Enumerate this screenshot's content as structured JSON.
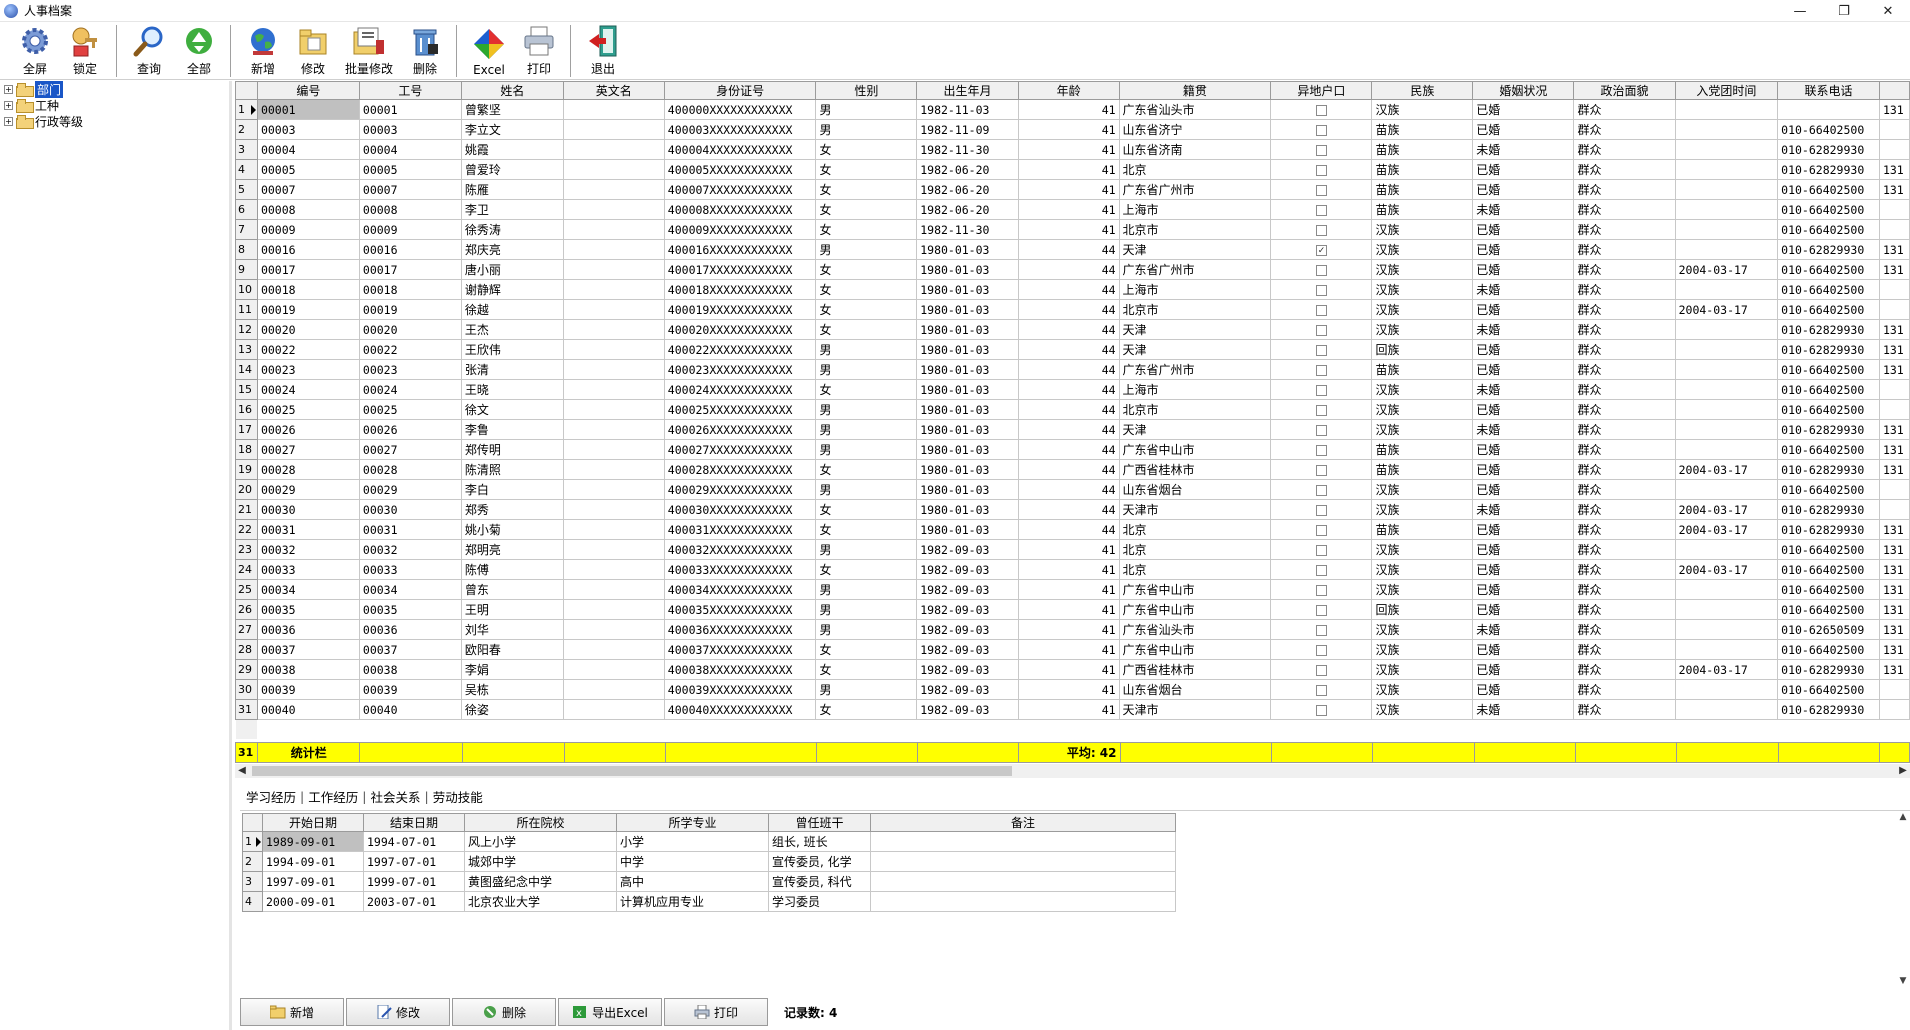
{
  "window": {
    "title": "人事档案",
    "controls": [
      "—",
      "❐",
      "✕"
    ]
  },
  "toolbar": {
    "groups": [
      [
        {
          "label": "全屏",
          "icon": "gear-icon"
        },
        {
          "label": "锁定",
          "icon": "lock-icon"
        }
      ],
      [
        {
          "label": "查询",
          "icon": "magnifier-icon"
        },
        {
          "label": "全部",
          "icon": "recycle-icon"
        }
      ],
      [
        {
          "label": "新增",
          "icon": "globe-icon"
        },
        {
          "label": "修改",
          "icon": "folder-edit-icon"
        },
        {
          "label": "批量修改",
          "icon": "batch-edit-icon"
        },
        {
          "label": "删除",
          "icon": "trash-icon"
        }
      ],
      [
        {
          "label": "Excel",
          "icon": "excel-icon"
        },
        {
          "label": "打印",
          "icon": "printer-icon"
        }
      ],
      [
        {
          "label": "退出",
          "icon": "exit-icon"
        }
      ]
    ]
  },
  "tree": [
    {
      "label": "部门",
      "checked": true,
      "selected": true
    },
    {
      "label": "工种",
      "checked": false,
      "selected": false
    },
    {
      "label": "行政等级",
      "checked": false,
      "selected": false
    }
  ],
  "grid": {
    "columns": [
      "编号",
      "工号",
      "姓名",
      "英文名",
      "身份证号",
      "性别",
      "出生年月",
      "年龄",
      "籍贯",
      "异地户口",
      "民族",
      "婚姻状况",
      "政治面貌",
      "入党团时间",
      "联系电话",
      ""
    ],
    "rows": [
      [
        "00001",
        "00001",
        "曾繁坚",
        "",
        "400000XXXXXXXXXXXX",
        "男",
        "1982-11-03",
        "41",
        "广东省汕头市",
        false,
        "汉族",
        "已婚",
        "群众",
        "",
        "",
        "131"
      ],
      [
        "00003",
        "00003",
        "李立文",
        "",
        "400003XXXXXXXXXXXX",
        "男",
        "1982-11-09",
        "41",
        "山东省济宁",
        false,
        "苗族",
        "已婚",
        "群众",
        "",
        "010-66402500",
        ""
      ],
      [
        "00004",
        "00004",
        "姚霞",
        "",
        "400004XXXXXXXXXXXX",
        "女",
        "1982-11-30",
        "41",
        "山东省济南",
        false,
        "苗族",
        "未婚",
        "群众",
        "",
        "010-62829930",
        ""
      ],
      [
        "00005",
        "00005",
        "曾爱玲",
        "",
        "400005XXXXXXXXXXXX",
        "女",
        "1982-06-20",
        "41",
        "北京",
        false,
        "苗族",
        "已婚",
        "群众",
        "",
        "010-62829930",
        "131"
      ],
      [
        "00007",
        "00007",
        "陈雁",
        "",
        "400007XXXXXXXXXXXX",
        "女",
        "1982-06-20",
        "41",
        "广东省广州市",
        false,
        "苗族",
        "已婚",
        "群众",
        "",
        "010-66402500",
        "131"
      ],
      [
        "00008",
        "00008",
        "李卫",
        "",
        "400008XXXXXXXXXXXX",
        "女",
        "1982-06-20",
        "41",
        "上海市",
        false,
        "苗族",
        "未婚",
        "群众",
        "",
        "010-66402500",
        ""
      ],
      [
        "00009",
        "00009",
        "徐秀涛",
        "",
        "400009XXXXXXXXXXXX",
        "女",
        "1982-11-30",
        "41",
        "北京市",
        false,
        "汉族",
        "已婚",
        "群众",
        "",
        "010-66402500",
        ""
      ],
      [
        "00016",
        "00016",
        "郑庆亮",
        "",
        "400016XXXXXXXXXXXX",
        "男",
        "1980-01-03",
        "44",
        "天津",
        true,
        "汉族",
        "已婚",
        "群众",
        "",
        "010-62829930",
        "131"
      ],
      [
        "00017",
        "00017",
        "唐小丽",
        "",
        "400017XXXXXXXXXXXX",
        "女",
        "1980-01-03",
        "44",
        "广东省广州市",
        false,
        "汉族",
        "已婚",
        "群众",
        "2004-03-17",
        "010-66402500",
        "131"
      ],
      [
        "00018",
        "00018",
        "谢静辉",
        "",
        "400018XXXXXXXXXXXX",
        "女",
        "1980-01-03",
        "44",
        "上海市",
        false,
        "汉族",
        "未婚",
        "群众",
        "",
        "010-66402500",
        ""
      ],
      [
        "00019",
        "00019",
        "徐越",
        "",
        "400019XXXXXXXXXXXX",
        "女",
        "1980-01-03",
        "44",
        "北京市",
        false,
        "汉族",
        "已婚",
        "群众",
        "2004-03-17",
        "010-66402500",
        ""
      ],
      [
        "00020",
        "00020",
        "王杰",
        "",
        "400020XXXXXXXXXXXX",
        "女",
        "1980-01-03",
        "44",
        "天津",
        false,
        "汉族",
        "未婚",
        "群众",
        "",
        "010-62829930",
        "131"
      ],
      [
        "00022",
        "00022",
        "王欣伟",
        "",
        "400022XXXXXXXXXXXX",
        "男",
        "1980-01-03",
        "44",
        "天津",
        false,
        "回族",
        "已婚",
        "群众",
        "",
        "010-62829930",
        "131"
      ],
      [
        "00023",
        "00023",
        "张清",
        "",
        "400023XXXXXXXXXXXX",
        "男",
        "1980-01-03",
        "44",
        "广东省广州市",
        false,
        "苗族",
        "已婚",
        "群众",
        "",
        "010-66402500",
        "131"
      ],
      [
        "00024",
        "00024",
        "王晓",
        "",
        "400024XXXXXXXXXXXX",
        "女",
        "1980-01-03",
        "44",
        "上海市",
        false,
        "汉族",
        "未婚",
        "群众",
        "",
        "010-66402500",
        ""
      ],
      [
        "00025",
        "00025",
        "徐文",
        "",
        "400025XXXXXXXXXXXX",
        "男",
        "1980-01-03",
        "44",
        "北京市",
        false,
        "汉族",
        "已婚",
        "群众",
        "",
        "010-66402500",
        ""
      ],
      [
        "00026",
        "00026",
        "李鲁",
        "",
        "400026XXXXXXXXXXXX",
        "男",
        "1980-01-03",
        "44",
        "天津",
        false,
        "汉族",
        "未婚",
        "群众",
        "",
        "010-62829930",
        "131"
      ],
      [
        "00027",
        "00027",
        "郑传明",
        "",
        "400027XXXXXXXXXXXX",
        "男",
        "1980-01-03",
        "44",
        "广东省中山市",
        false,
        "苗族",
        "已婚",
        "群众",
        "",
        "010-66402500",
        "131"
      ],
      [
        "00028",
        "00028",
        "陈清照",
        "",
        "400028XXXXXXXXXXXX",
        "女",
        "1980-01-03",
        "44",
        "广西省桂林市",
        false,
        "苗族",
        "已婚",
        "群众",
        "2004-03-17",
        "010-62829930",
        "131"
      ],
      [
        "00029",
        "00029",
        "李白",
        "",
        "400029XXXXXXXXXXXX",
        "男",
        "1980-01-03",
        "44",
        "山东省烟台",
        false,
        "汉族",
        "已婚",
        "群众",
        "",
        "010-66402500",
        ""
      ],
      [
        "00030",
        "00030",
        "郑秀",
        "",
        "400030XXXXXXXXXXXX",
        "女",
        "1980-01-03",
        "44",
        "天津市",
        false,
        "汉族",
        "未婚",
        "群众",
        "2004-03-17",
        "010-62829930",
        ""
      ],
      [
        "00031",
        "00031",
        "姚小菊",
        "",
        "400031XXXXXXXXXXXX",
        "女",
        "1980-01-03",
        "44",
        "北京",
        false,
        "苗族",
        "已婚",
        "群众",
        "2004-03-17",
        "010-62829930",
        "131"
      ],
      [
        "00032",
        "00032",
        "郑明亮",
        "",
        "400032XXXXXXXXXXXX",
        "男",
        "1982-09-03",
        "41",
        "北京",
        false,
        "汉族",
        "已婚",
        "群众",
        "",
        "010-66402500",
        "131"
      ],
      [
        "00033",
        "00033",
        "陈傅",
        "",
        "400033XXXXXXXXXXXX",
        "女",
        "1982-09-03",
        "41",
        "北京",
        false,
        "汉族",
        "已婚",
        "群众",
        "2004-03-17",
        "010-66402500",
        "131"
      ],
      [
        "00034",
        "00034",
        "曾东",
        "",
        "400034XXXXXXXXXXXX",
        "男",
        "1982-09-03",
        "41",
        "广东省中山市",
        false,
        "汉族",
        "已婚",
        "群众",
        "",
        "010-66402500",
        "131"
      ],
      [
        "00035",
        "00035",
        "王明",
        "",
        "400035XXXXXXXXXXXX",
        "男",
        "1982-09-03",
        "41",
        "广东省中山市",
        false,
        "回族",
        "已婚",
        "群众",
        "",
        "010-66402500",
        "131"
      ],
      [
        "00036",
        "00036",
        "刘华",
        "",
        "400036XXXXXXXXXXXX",
        "男",
        "1982-09-03",
        "41",
        "广东省汕头市",
        false,
        "汉族",
        "未婚",
        "群众",
        "",
        "010-62650509",
        "131"
      ],
      [
        "00037",
        "00037",
        "欧阳春",
        "",
        "400037XXXXXXXXXXXX",
        "女",
        "1982-09-03",
        "41",
        "广东省中山市",
        false,
        "汉族",
        "已婚",
        "群众",
        "",
        "010-66402500",
        "131"
      ],
      [
        "00038",
        "00038",
        "李娟",
        "",
        "400038XXXXXXXXXXXX",
        "女",
        "1982-09-03",
        "41",
        "广西省桂林市",
        false,
        "汉族",
        "已婚",
        "群众",
        "2004-03-17",
        "010-62829930",
        "131"
      ],
      [
        "00039",
        "00039",
        "吴栋",
        "",
        "400039XXXXXXXXXXXX",
        "男",
        "1982-09-03",
        "41",
        "山东省烟台",
        false,
        "汉族",
        "已婚",
        "群众",
        "",
        "010-66402500",
        ""
      ],
      [
        "00040",
        "00040",
        "徐姿",
        "",
        "400040XXXXXXXXXXXX",
        "女",
        "1982-09-03",
        "41",
        "天津市",
        false,
        "汉族",
        "未婚",
        "群众",
        "",
        "010-62829930",
        ""
      ]
    ]
  },
  "summary": {
    "row_number": "31",
    "label": "统计栏",
    "age_avg": "平均: 42"
  },
  "tabs": [
    "学习经历",
    "工作经历",
    "社会关系",
    "劳动技能"
  ],
  "detail": {
    "columns": [
      "开始日期",
      "结束日期",
      "所在院校",
      "所学专业",
      "曾任班干",
      "备注"
    ],
    "rows": [
      [
        "1989-09-01",
        "1994-07-01",
        "风上小学",
        "小学",
        "组长, 班长",
        ""
      ],
      [
        "1994-09-01",
        "1997-07-01",
        "城郊中学",
        "中学",
        "宣传委员, 化学",
        ""
      ],
      [
        "1997-09-01",
        "1999-07-01",
        "黄图盛纪念中学",
        "高中",
        "宣传委员, 科代",
        ""
      ],
      [
        "2000-09-01",
        "2003-07-01",
        "北京农业大学",
        "计算机应用专业",
        "学习委员",
        ""
      ]
    ]
  },
  "bottom": {
    "buttons": [
      {
        "label": "新增",
        "icon": "folder-add-icon"
      },
      {
        "label": "修改",
        "icon": "edit-doc-icon"
      },
      {
        "label": "删除",
        "icon": "delete-icon"
      },
      {
        "label": "导出Excel",
        "icon": "excel-small-icon"
      },
      {
        "label": "打印",
        "icon": "print-small-icon"
      }
    ],
    "record_count": "记录数: 4"
  }
}
